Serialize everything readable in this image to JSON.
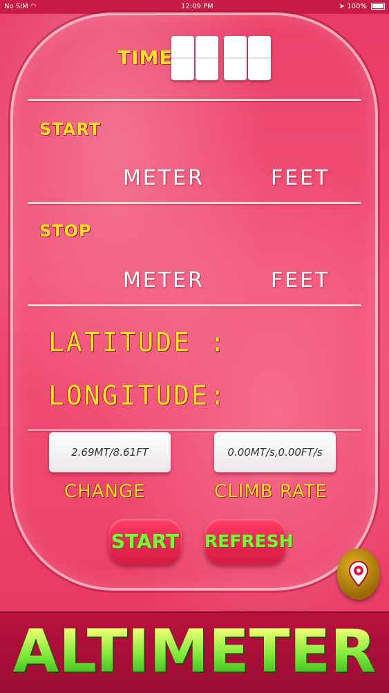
{
  "status_bar": {
    "carrier": "No SIM",
    "time": "12:09 PM",
    "battery": "100%"
  },
  "time_section": {
    "label": "TIME"
  },
  "start_section": {
    "label": "START",
    "meter_label": "METER",
    "feet_label": "FEET"
  },
  "stop_section": {
    "label": "STOP",
    "meter_label": "METER",
    "feet_label": "FEET"
  },
  "location": {
    "latitude_label": "LATITUDE :",
    "longitude_label": "LONGITUDE:"
  },
  "readouts": {
    "change_value": "2.69MT/8.61FT",
    "change_label": "CHANGE",
    "climb_value": "0.00MT/s,0.00FT/s",
    "climb_label": "CLIMB RATE"
  },
  "buttons": {
    "start": "START",
    "refresh": "REFRESH"
  },
  "footer": {
    "title": "ALTIMETER"
  },
  "colors": {
    "accent_yellow": "#ffe12a",
    "button_text_green": "#7ef53a",
    "background_pink": "#ee4670"
  },
  "icons": {
    "status_wifi": "wifi-icon",
    "status_location": "location-arrow-icon",
    "map_pin": "map-pin-icon"
  }
}
